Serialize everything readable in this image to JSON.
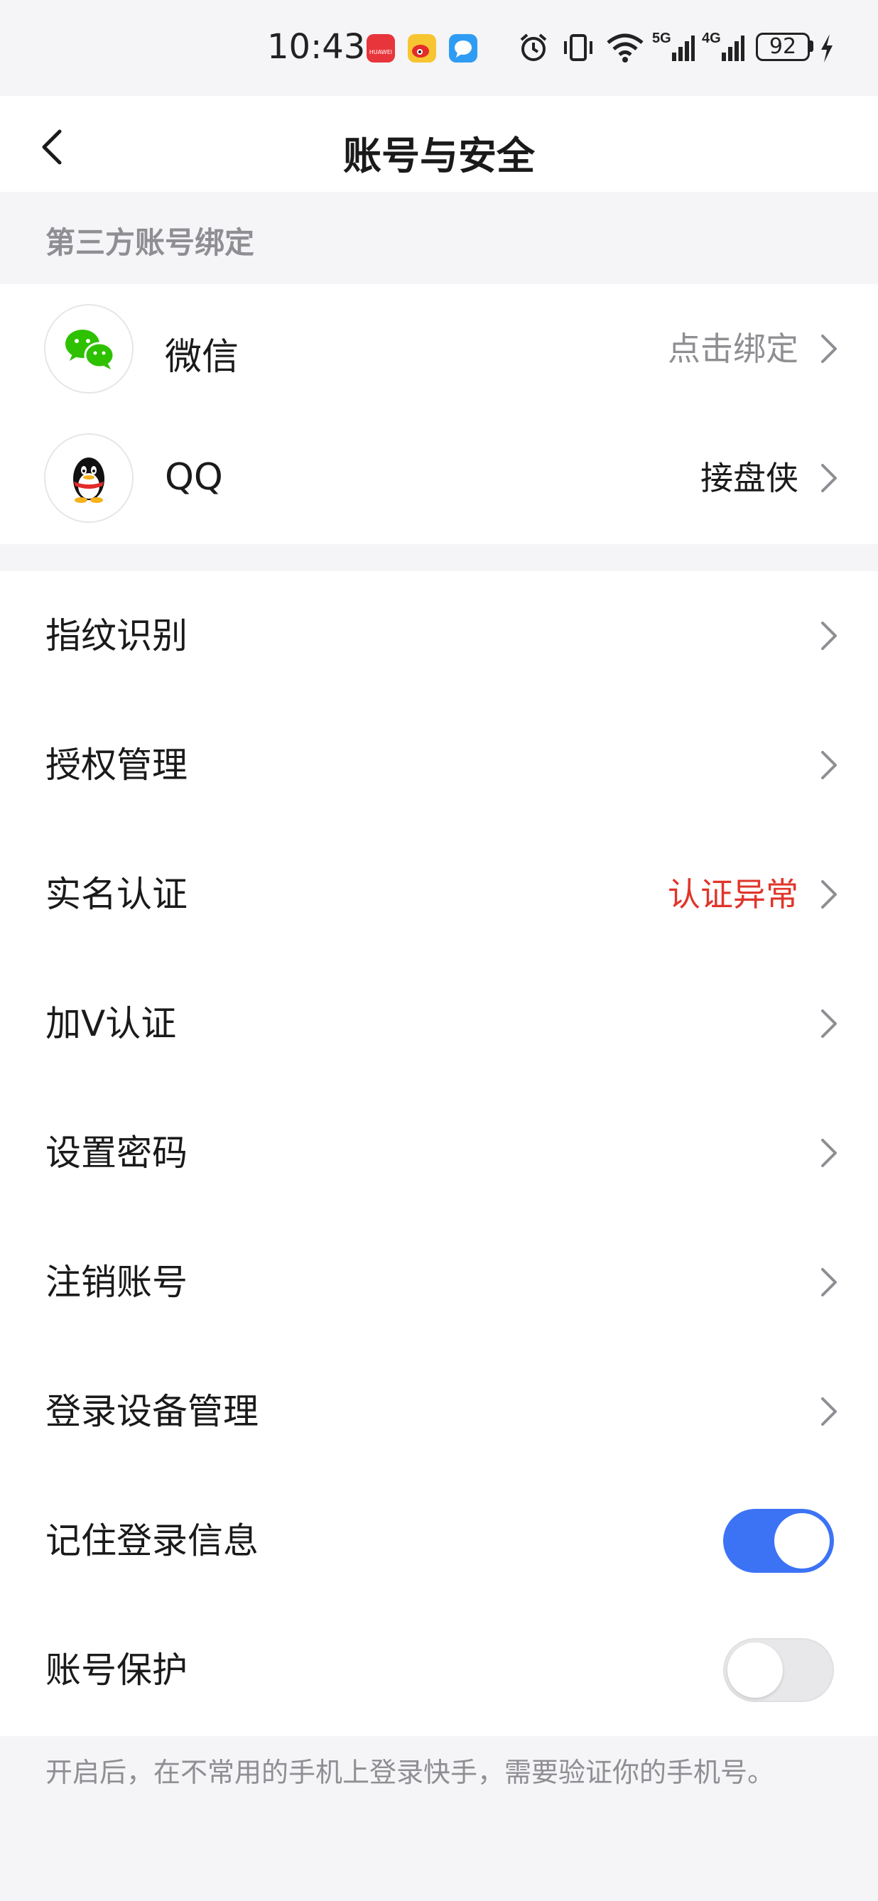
{
  "status_bar": {
    "time": "10:43",
    "apps": [
      "huawei-appgallery-icon",
      "weibo-icon",
      "message-icon"
    ],
    "battery": "92",
    "network": [
      "5G",
      "4G"
    ]
  },
  "header": {
    "title": "账号与安全"
  },
  "third_party": {
    "section_label": "第三方账号绑定",
    "items": [
      {
        "label": "微信",
        "value": "点击绑定",
        "value_color": "#8e8e93",
        "icon": "wechat-icon"
      },
      {
        "label": "QQ",
        "value": "接盘侠",
        "value_color": "#1a1a1a",
        "icon": "qq-icon"
      }
    ]
  },
  "settings": {
    "items": [
      {
        "label": "指纹识别",
        "value": ""
      },
      {
        "label": "授权管理",
        "value": ""
      },
      {
        "label": "实名认证",
        "value": "认证异常",
        "value_color": "#e0352b"
      },
      {
        "label": "加V认证",
        "value": ""
      },
      {
        "label": "设置密码",
        "value": ""
      },
      {
        "label": "注销账号",
        "value": ""
      },
      {
        "label": "登录设备管理",
        "value": ""
      }
    ],
    "toggles": [
      {
        "label": "记住登录信息",
        "on": true
      },
      {
        "label": "账号保护",
        "on": false
      }
    ],
    "hint": "开启后，在不常用的手机上登录快手，需要验证你的手机号。"
  },
  "colors": {
    "accent": "#3c73f5",
    "danger": "#e0352b",
    "toggle_off": "#e8e8ea"
  }
}
